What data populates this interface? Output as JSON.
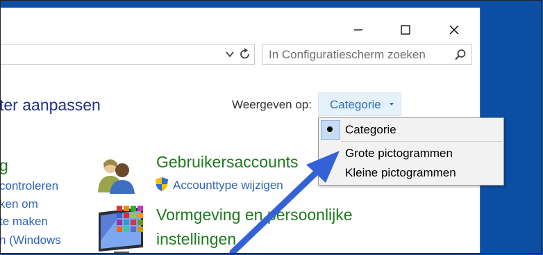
{
  "header": {
    "heading_partial": "ter aanpassen"
  },
  "search": {
    "placeholder": "In Configuratiescherm zoeken"
  },
  "view": {
    "label": "Weergeven op:",
    "current": "Categorie"
  },
  "menu": {
    "items": [
      {
        "label": "Categorie",
        "selected": true
      },
      {
        "label": "Grote pictogrammen",
        "selected": false
      },
      {
        "label": "Kleine pictogrammen",
        "selected": false
      }
    ]
  },
  "left_column": {
    "title_partial": "g",
    "links": [
      "controleren",
      "ken om",
      "te maken",
      "n (Windows"
    ]
  },
  "categories": [
    {
      "title": "Gebruikersaccounts",
      "links": [
        "Accounttype wijzigen"
      ]
    },
    {
      "title_line1": "Vormgeving en persoonlijke",
      "title_line2": "instellingen"
    }
  ],
  "colors": {
    "accent": "#2b6fc4",
    "green_title": "#1d7a1d",
    "arrow": "#3461d6",
    "desktop": "#0b4ea2"
  }
}
